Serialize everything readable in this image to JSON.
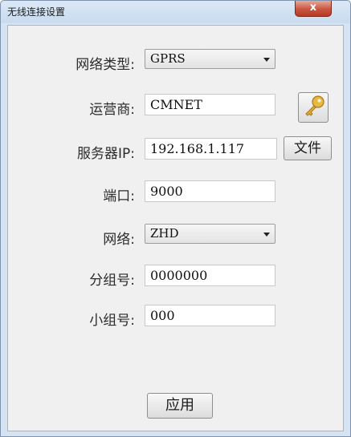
{
  "window": {
    "title": "无线连接设置",
    "close_glyph": "x"
  },
  "form": {
    "network_type": {
      "label": "网络类型:",
      "value": "GPRS"
    },
    "operator": {
      "label": "运营商:",
      "value": "CMNET"
    },
    "server_ip": {
      "label": "服务器IP:",
      "value": "192.168.1.117"
    },
    "port": {
      "label": "端口:",
      "value": "9000"
    },
    "network": {
      "label": "网络:",
      "value": "ZHD"
    },
    "group_number": {
      "label": "分组号:",
      "value": "0000000"
    },
    "subgroup_number": {
      "label": "小组号:",
      "value": "000"
    }
  },
  "buttons": {
    "key_icon": "key-icon",
    "file_label": "文件",
    "apply_label": "应用"
  }
}
